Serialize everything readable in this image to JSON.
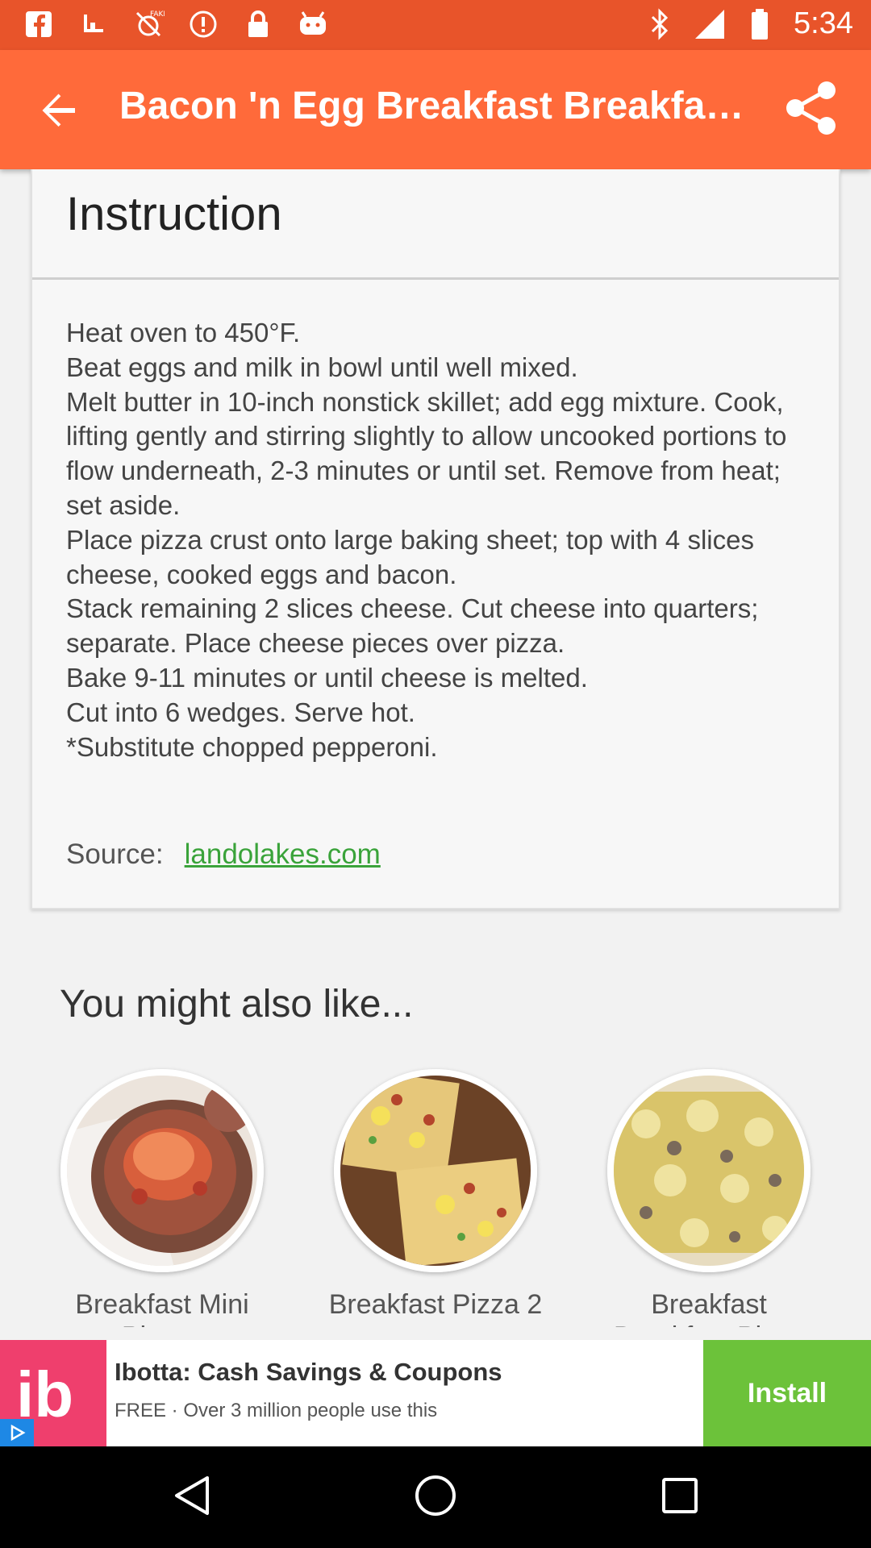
{
  "status_bar": {
    "time": "5:34",
    "left_icons": [
      "facebook-icon",
      "download-icon",
      "fake-gps-icon",
      "alert-icon",
      "lock-icon",
      "android-icon"
    ],
    "right_icons": [
      "bluetooth-icon",
      "signal-icon",
      "battery-icon"
    ]
  },
  "app_bar": {
    "title": "Bacon 'n Egg Breakfast Breakfa…",
    "back_icon": "arrow-back-icon",
    "share_icon": "share-icon"
  },
  "instruction": {
    "title": "Instruction",
    "steps": [
      "Heat oven to 450°F.",
      "Beat eggs and milk in bowl until well mixed.",
      "Melt butter in 10-inch nonstick skillet; add egg mixture. Cook, lifting gently and stirring slightly to allow uncooked portions to flow underneath, 2-3 minutes or until set. Remove from heat; set aside.",
      "Place pizza crust onto large baking sheet; top with 4 slices cheese, cooked eggs and bacon.",
      "Stack remaining 2 slices cheese. Cut cheese into quarters; separate. Place cheese pieces over pizza.",
      "Bake 9-11 minutes or until cheese is melted.",
      "Cut into 6 wedges. Serve hot.",
      "*Substitute chopped pepperoni."
    ],
    "source_label": "Source:",
    "source_link": " landolakes.com"
  },
  "suggestions": {
    "heading": "You might also like...",
    "items": [
      {
        "label": "Breakfast Mini Pizzas"
      },
      {
        "label": "Breakfast Pizza 2"
      },
      {
        "label": "Breakfast Breakfast Pizza"
      }
    ]
  },
  "ad": {
    "logo_text": "ib",
    "title": "Ibotta: Cash Savings & Coupons",
    "subtitle": "FREE · Over 3 million people use this",
    "install_label": "Install"
  },
  "nav_bar": {
    "icons": [
      "back-triangle-icon",
      "home-circle-icon",
      "recents-square-icon"
    ]
  },
  "colors": {
    "status_bar": "#e8542a",
    "app_bar": "#ff6a3a",
    "link": "#3aa33a",
    "ad_install": "#6cc23a",
    "ad_logo": "#ef3f6d"
  }
}
